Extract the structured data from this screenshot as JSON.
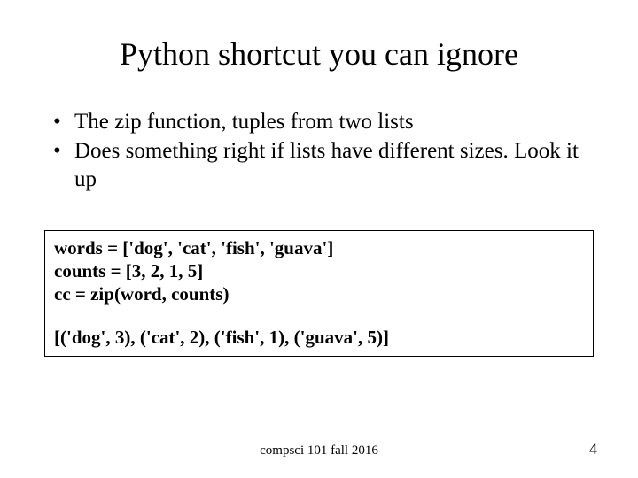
{
  "title": "Python shortcut you can ignore",
  "bullets": [
    "The zip function, tuples from two lists",
    "Does something right if lists have different sizes. Look it up"
  ],
  "code": {
    "line1": "words = ['dog', 'cat', 'fish', 'guava']",
    "line2": "counts = [3, 2, 1, 5]",
    "line3": "cc = zip(word, counts)",
    "output": "[('dog', 3), ('cat', 2), ('fish', 1), ('guava', 5)]"
  },
  "footer": "compsci 101 fall 2016",
  "page_number": "4"
}
